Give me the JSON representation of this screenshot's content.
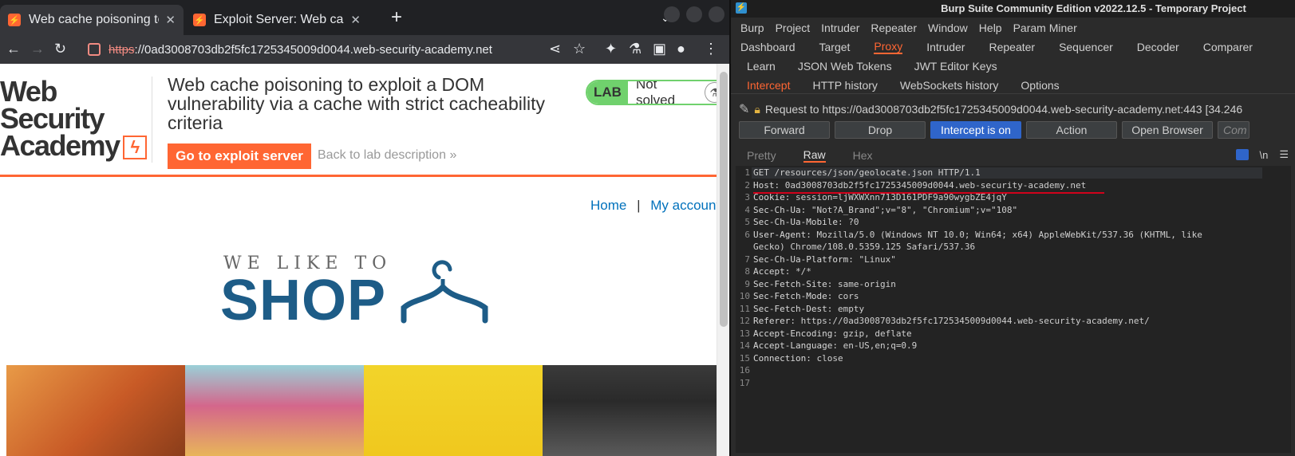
{
  "browser": {
    "tabs": [
      {
        "title": "Web cache poisoning to e",
        "active": true
      },
      {
        "title": "Exploit Server: Web cache",
        "active": false
      }
    ],
    "url": {
      "scheme": "https",
      "rest": "://0ad3008703db2f5fc1725345009d0044.web-security-academy.net"
    },
    "logo": {
      "line1": "Web Security",
      "line2": "Academy"
    },
    "lab_title": "Web cache poisoning to exploit a DOM vulnerability via a cache with strict cacheability criteria",
    "exploit_button": "Go to exploit server",
    "back_link": "Back to lab description",
    "back_chevron": "»",
    "lab_badge": {
      "label": "LAB",
      "status": "Not solved"
    },
    "nav": {
      "home": "Home",
      "sep": "|",
      "account": "My account"
    },
    "banner": {
      "small": "WE LIKE TO",
      "big": "SHOP"
    }
  },
  "burp": {
    "title": "Burp Suite Community Edition v2022.12.5 - Temporary Project",
    "menu": [
      "Burp",
      "Project",
      "Intruder",
      "Repeater",
      "Window",
      "Help",
      "Param Miner"
    ],
    "main_tabs": [
      "Dashboard",
      "Target",
      "Proxy",
      "Intruder",
      "Repeater",
      "Sequencer",
      "Decoder",
      "Comparer"
    ],
    "main_tabs_selected": "Proxy",
    "extra_tabs": [
      "Learn",
      "JSON Web Tokens",
      "JWT Editor Keys"
    ],
    "proxy_tabs": [
      "Intercept",
      "HTTP history",
      "WebSockets history",
      "Options"
    ],
    "proxy_tabs_selected": "Intercept",
    "request_line": "Request to https://0ad3008703db2f5fc1725345009d0044.web-security-academy.net:443  [34.246",
    "buttons": [
      "Forward",
      "Drop",
      "Intercept is on",
      "Action",
      "Open Browser",
      "Com"
    ],
    "view_tabs": [
      "Pretty",
      "Raw",
      "Hex"
    ],
    "view_selected": "Raw",
    "newline_toggle": "\\n",
    "lines": [
      {
        "n": "1",
        "text": "GET /resources/json/geolocate.json HTTP/1.1"
      },
      {
        "n": "2",
        "key": "Host",
        "val": ": 0ad3008703db2f5fc1725345009d0044.web-security-academy.net"
      },
      {
        "n": "3",
        "key": "Cookie",
        "val": ": session=ljWXWXnn713D161PDF9a90wygbZE4jqY"
      },
      {
        "n": "4",
        "key": "Sec-Ch-Ua",
        "val": ": \"Not?A_Brand\";v=\"8\", \"Chromium\";v=\"108\""
      },
      {
        "n": "5",
        "key": "Sec-Ch-Ua-Mobile",
        "val": ": ?0"
      },
      {
        "n": "6",
        "key": "User-Agent",
        "val": ": Mozilla/5.0 (Windows NT 10.0; Win64; x64) AppleWebKit/537.36 (KHTML, like"
      },
      {
        "n": "",
        "text": "Gecko) Chrome/108.0.5359.125 Safari/537.36"
      },
      {
        "n": "7",
        "key": "Sec-Ch-Ua-Platform",
        "val": ": \"Linux\""
      },
      {
        "n": "8",
        "key": "Accept",
        "val": ": */*"
      },
      {
        "n": "9",
        "key": "Sec-Fetch-Site",
        "val": ": same-origin"
      },
      {
        "n": "10",
        "key": "Sec-Fetch-Mode",
        "val": ": cors"
      },
      {
        "n": "11",
        "key": "Sec-Fetch-Dest",
        "val": ": empty"
      },
      {
        "n": "12",
        "key": "Referer",
        "val": ": https://0ad3008703db2f5fc1725345009d0044.web-security-academy.net/"
      },
      {
        "n": "13",
        "key": "Accept-Encoding",
        "val": ": gzip, deflate"
      },
      {
        "n": "14",
        "key": "Accept-Language",
        "val": ": en-US,en;q=0.9"
      },
      {
        "n": "15",
        "key": "Connection",
        "val": ": close"
      },
      {
        "n": "16",
        "text": ""
      },
      {
        "n": "17",
        "text": ""
      }
    ]
  },
  "colors": {
    "accent": "#ff6633",
    "burp_selected": "#2f65ca",
    "lab_green": "#70d16d"
  }
}
